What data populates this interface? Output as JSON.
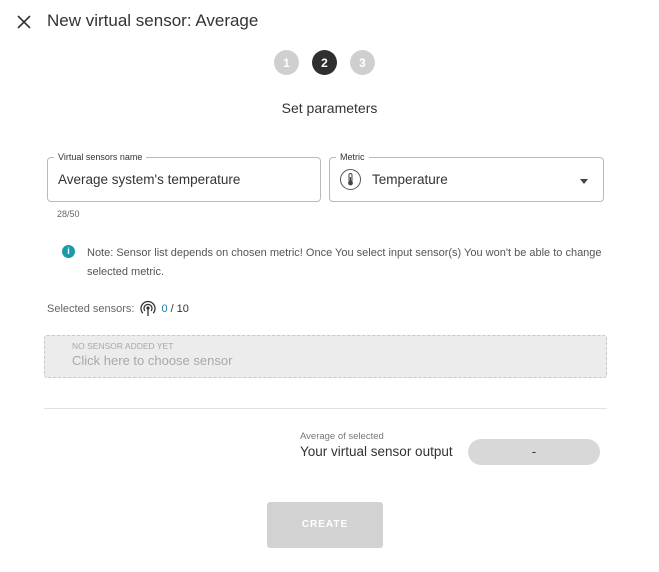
{
  "header": {
    "title": "New virtual sensor: Average",
    "close_icon": "close-icon"
  },
  "stepper": {
    "steps": [
      "1",
      "2",
      "3"
    ],
    "active_step": "2"
  },
  "subtitle": "Set parameters",
  "form": {
    "name_field": {
      "label": "Virtual sensors name",
      "value": "Average system's temperature",
      "counter": "28/50"
    },
    "metric_field": {
      "label": "Metric",
      "value": "Temperature",
      "icon": "thermometer-icon"
    }
  },
  "note": {
    "icon": "info-icon",
    "text": "Note: Sensor list depends on chosen metric! Once You select input sensor(s) You won't be able to change selected metric."
  },
  "selected_sensors": {
    "label": "Selected sensors:",
    "icon": "sensor-signal-icon",
    "current": "0",
    "separator": "/",
    "max": "10"
  },
  "sensor_picker": {
    "empty_label": "NO SENSOR ADDED YET",
    "hint": "Click here to choose sensor"
  },
  "output": {
    "caption": "Average of selected",
    "label": "Your virtual sensor output",
    "value": "-"
  },
  "actions": {
    "create_label": "CREATE"
  },
  "colors": {
    "accent": "#1a9aa8",
    "active_step": "#2f2f2f",
    "inactive_step": "#cfcfcf",
    "disabled_button": "#d2d2d2"
  }
}
